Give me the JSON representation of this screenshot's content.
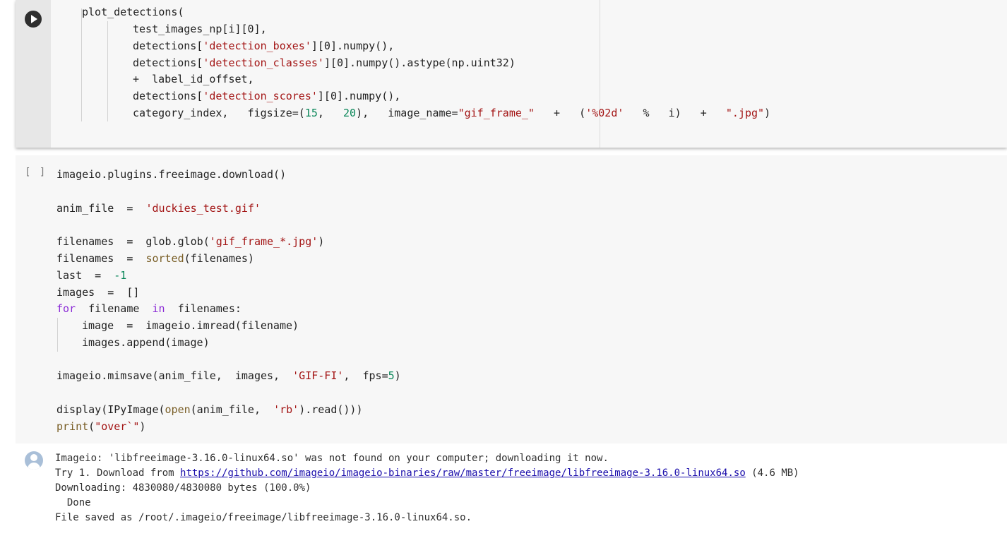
{
  "cell1": {
    "lines": [
      "plot_detections(",
      "test_images_np[i][0],",
      [
        "detections[",
        "'detection_boxes'",
        "][0].numpy(),"
      ],
      [
        "detections[",
        "'detection_classes'",
        "][0].numpy().astype(np.uint32)"
      ],
      "+  label_id_offset,",
      [
        "detections[",
        "'detection_scores'",
        "][0].numpy(),"
      ],
      [
        "category_index,   figsize=(",
        "15",
        ",   ",
        "20",
        "),   image_name=",
        "\"gif_frame_\"",
        "   +   (",
        "'%02d'",
        "   %   i)   +   ",
        "\".jpg\"",
        ")"
      ]
    ]
  },
  "cell2": {
    "exec_count": "[ ]",
    "lines": {
      "l1": "imageio.plugins.freeimage.download()",
      "l2": [
        "anim_file  =  ",
        "'duckies_test.gif'"
      ],
      "l3": [
        "filenames  =  glob.glob(",
        "'gif_frame_*.jpg'",
        ")"
      ],
      "l4": [
        "filenames  =  ",
        "sorted",
        "(filenames)"
      ],
      "l5": [
        "last  =  ",
        "-1"
      ],
      "l6": "images  =  []",
      "l7": [
        "for",
        "  filename  ",
        "in",
        "  filenames:"
      ],
      "l8": "image  =  imageio.imread(filename)",
      "l9": "images.append(image)",
      "l10": [
        "imageio.mimsave(anim_file,  images,  ",
        "'GIF-FI'",
        ",  fps=",
        "5",
        ")"
      ],
      "l11": [
        "display(IPyImage(",
        "open",
        "(anim_file,  ",
        "'rb'",
        ").read()))"
      ],
      "l12": [
        "print",
        "(",
        "\"over`\"",
        ")"
      ]
    }
  },
  "output": {
    "line1": "Imageio: 'libfreeimage-3.16.0-linux64.so' was not found on your computer; downloading it now.",
    "line2_prefix": "Try 1. Download from ",
    "line2_link": "https://github.com/imageio/imageio-binaries/raw/master/freeimage/libfreeimage-3.16.0-linux64.so",
    "line2_suffix": " (4.6 MB)",
    "line3": "Downloading: 4830080/4830080 bytes (100.0%)",
    "line4": "  Done",
    "line5": "File saved as /root/.imageio/freeimage/libfreeimage-3.16.0-linux64.so."
  },
  "colors": {
    "string": "#a31515",
    "number": "#098658",
    "keyword": "#8b2bd6",
    "builtin": "#795e26",
    "link": "#1a0dab"
  },
  "icons": {
    "run": "play-circle-icon",
    "output": "user-avatar-icon"
  }
}
